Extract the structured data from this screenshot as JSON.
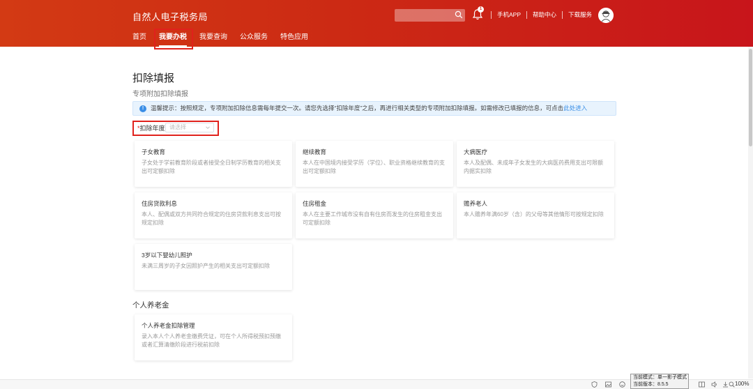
{
  "header": {
    "brand": "自然人电子税务局",
    "nav": [
      "首页",
      "我要办税",
      "我要查询",
      "公众服务",
      "特色应用"
    ],
    "search": {
      "value": "",
      "placeholder": ""
    },
    "bell_badge": "1",
    "links": [
      "手机APP",
      "帮助中心",
      "下载服务"
    ]
  },
  "page": {
    "title": "扣除填报",
    "section1": "专项附加扣除填报",
    "notice_text": "温馨提示：按照规定，专项附加扣除信息需每年提交一次。请您先选择“扣除年度”之后，再进行相关类型的专项附加扣除填报。如需修改已填报的信息，可点击",
    "notice_link": "此处进入",
    "year_label": "扣除年度",
    "year_required": "*",
    "year_placeholder": "请选择",
    "cards": [
      {
        "title": "子女教育",
        "desc": "子女处于学前教育阶段或者接受全日制学历教育的相关支出可定额扣除"
      },
      {
        "title": "继续教育",
        "desc": "本人在中国境内接受学历（学位）、职业资格继续教育的支出可定额扣除"
      },
      {
        "title": "大病医疗",
        "desc": "本人及配偶、未成年子女发生的大病医药费用支出可限额内据实扣除"
      },
      {
        "title": "住房贷款利息",
        "desc": "本人、配偶或双方共同符合规定的住房贷款利息支出可按规定扣除"
      },
      {
        "title": "住房租金",
        "desc": "本人在主要工作城市没有自有住房而发生的住房租金支出可定额扣除"
      },
      {
        "title": "赡养老人",
        "desc": "本人赡养年满60岁（含）的父母等其他情形可按规定扣除"
      },
      {
        "title": "3岁以下婴幼儿照护",
        "desc": "未满三周岁的子女因照护产生的相关支出可定额扣除"
      }
    ],
    "section2": "个人养老金",
    "pension_card": {
      "title": "个人养老金扣除管理",
      "desc": "录入本人个人养老金缴费凭证，可在个人所得税预扣预缴或者汇算清缴阶段进行税前扣除"
    }
  },
  "statusbar": {
    "tooltip_line1": "当前模式：单一影子模式",
    "tooltip_line2": "当前版本：8.5.5",
    "zoom": "100%"
  },
  "colors": {
    "header_start": "#d33a14",
    "header_end": "#c8151b",
    "highlight": "#e0211c",
    "link": "#3a8ee6"
  }
}
